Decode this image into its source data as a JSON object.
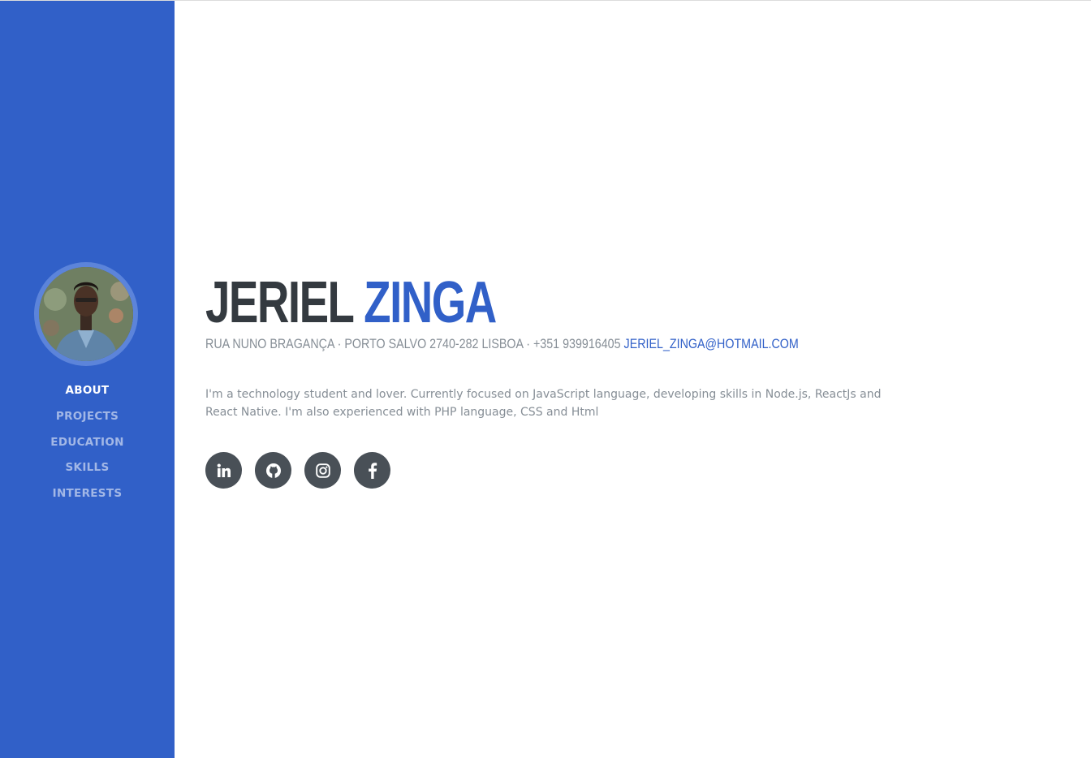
{
  "sidebar": {
    "avatar_alt": "Jeriel Zinga",
    "nav": [
      {
        "label": "ABOUT",
        "active": true
      },
      {
        "label": "PROJECTS",
        "active": false
      },
      {
        "label": "EDUCATION",
        "active": false
      },
      {
        "label": "SKILLS",
        "active": false
      },
      {
        "label": "INTERESTS",
        "active": false
      }
    ]
  },
  "about": {
    "first_name": "JERIEL",
    "last_name": "ZINGA",
    "address": "RUA NUNO BRAGANÇA · PORTO SALVO 2740-282 LISBOA · +351 939916405",
    "email": "JERIEL_ZINGA@HOTMAIL.COM",
    "bio": "I'm a technology student and lover. Currently focused on JavaScript language, developing skills in Node.js, ReactJs and React Native. I'm also experienced with PHP language, CSS and Html"
  },
  "socials": [
    {
      "icon": "linkedin-icon"
    },
    {
      "icon": "github-icon"
    },
    {
      "icon": "instagram-icon"
    },
    {
      "icon": "facebook-icon"
    }
  ],
  "colors": {
    "primary": "#3160c8",
    "dark": "#343a40",
    "muted": "#868e96",
    "social_bg": "#495057"
  }
}
